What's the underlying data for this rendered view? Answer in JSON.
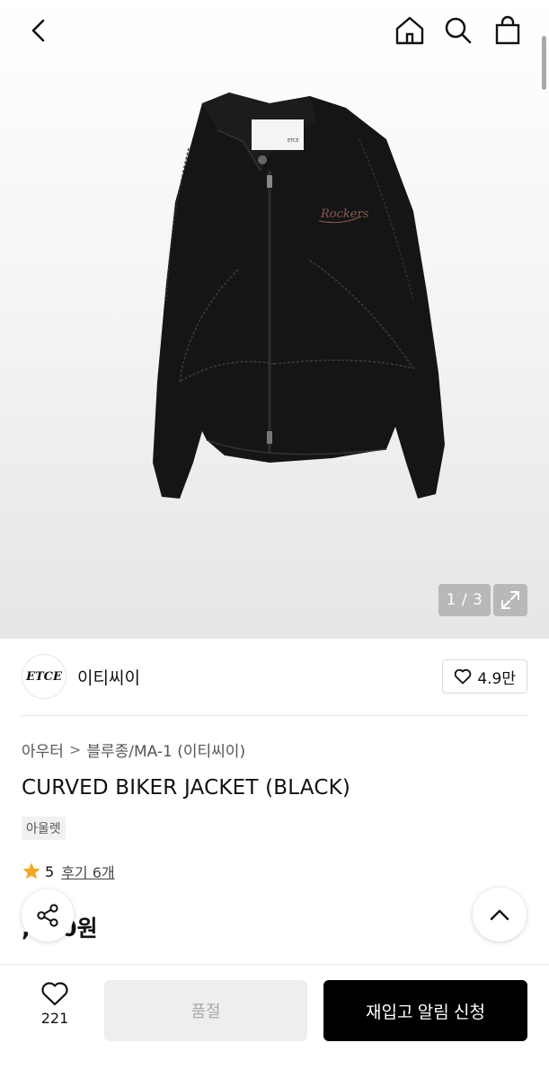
{
  "header": {
    "back_icon": "chevron-left-icon",
    "home_icon": "home-icon",
    "search_icon": "search-icon",
    "bag_icon": "shopping-bag-icon"
  },
  "gallery": {
    "pager": "1 / 3",
    "expand_icon": "expand-icon",
    "jacket_logo_text": "Rockers"
  },
  "brand": {
    "logo_text": "ETCE",
    "name": "이티씨이",
    "likes": "4.9만"
  },
  "breadcrumb": {
    "category": "아우터",
    "separator": ">",
    "subcategory": "블루종/MA-1 (이티씨이)"
  },
  "product": {
    "title": "CURVED BIKER JACKET (BLACK)",
    "tag": "아울렛",
    "rating": "5",
    "reviews": "후기 6개",
    "price": ",000원"
  },
  "bottom": {
    "wish_count": "221",
    "soldout_label": "품절",
    "restock_label": "재입고 알림 신청"
  },
  "colors": {
    "accent_star": "#f5a623",
    "primary_button": "#000000",
    "disabled_button": "#eeeeee"
  }
}
